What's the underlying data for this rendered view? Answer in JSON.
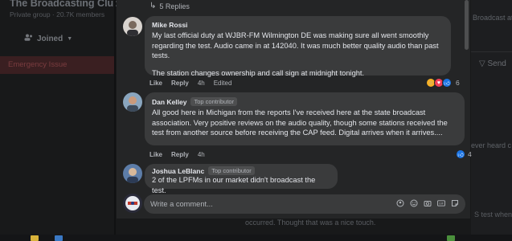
{
  "background": {
    "group_title": "The Broadcasting Club",
    "group_subtitle": "Private group · 20.7K members",
    "joined_label": "Joined",
    "red_banner_text": "Emergency Issue",
    "right_top_text": "Broadcast at",
    "send_label": "Send",
    "never_text": "ever heard c",
    "occurred_text": "occurred. Thought that was a nice touch.",
    "test_text": "S test when"
  },
  "thread": {
    "replies_label": "5 Replies",
    "comments": [
      {
        "author": "Mike Rossi",
        "badge": "",
        "paragraphs": [
          "My last official duty at WJBR-FM Wilmington DE was making sure all went smoothly regarding the test. Audio came in at 142040. It was much better quality audio than past tests.",
          "The station changes ownership and call sign at midnight tonight."
        ],
        "like_label": "Like",
        "reply_label": "Reply",
        "time": "4h",
        "edited_label": "Edited",
        "reaction_count": "6",
        "reactions": [
          "haha",
          "love",
          "like"
        ]
      },
      {
        "author": "Dan Kelley",
        "badge": "Top contributor",
        "paragraphs": [
          "All good here in Michigan from the reports I've received here at the state broadcast association. Very positive reviews on the audio quality, though some stations received the test from another source before receiving the CAP feed. Digital arrives when it arrives...."
        ],
        "like_label": "Like",
        "reply_label": "Reply",
        "time": "4h",
        "edited_label": "",
        "reaction_count": "4",
        "reactions": [
          "like"
        ]
      },
      {
        "author": "Joshua LeBlanc",
        "badge": "Top contributor",
        "paragraphs": [
          "2 of the LPFMs in our market didn't broadcast the test."
        ],
        "like_label": "",
        "reply_label": "",
        "time": "",
        "edited_label": "",
        "reaction_count": "",
        "reactions": []
      }
    ]
  },
  "composer": {
    "placeholder": "Write a comment...",
    "icons": [
      "gif-icon",
      "sticker-icon",
      "camera-icon",
      "emoji-icon",
      "avatar-sticker-icon"
    ]
  },
  "colors": {
    "modal_bg": "#242526",
    "bubble_bg": "#3a3b3c",
    "text_primary": "#e4e6eb",
    "text_secondary": "#b0b3b8",
    "like_blue": "#1b74e4"
  }
}
